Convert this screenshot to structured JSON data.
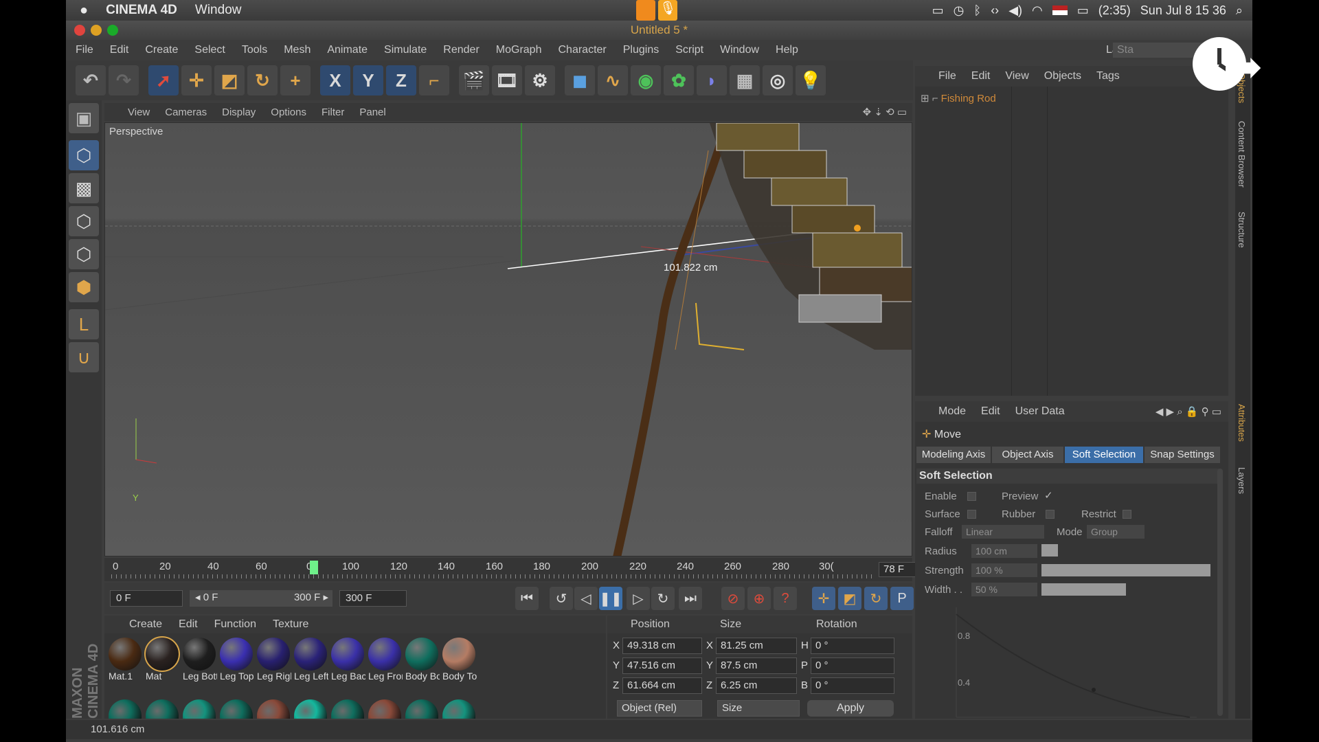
{
  "mac_menubar": {
    "app_name": "CINEMA 4D",
    "window_menu": "Window",
    "battery": "(2:35)",
    "clock": "Sun Jul 8  15 36"
  },
  "window": {
    "title": "Untitled 5 *"
  },
  "main_menu": [
    "File",
    "Edit",
    "Create",
    "Select",
    "Tools",
    "Mesh",
    "Animate",
    "Simulate",
    "Render",
    "MoGraph",
    "Character",
    "Plugins",
    "Script",
    "Window",
    "Help"
  ],
  "layout": {
    "label": "Layout:",
    "value": "Sta"
  },
  "toolbar": {
    "axis_x": "X",
    "axis_y": "Y",
    "axis_z": "Z"
  },
  "viewport": {
    "menu": [
      "View",
      "Cameras",
      "Display",
      "Options",
      "Filter",
      "Panel"
    ],
    "label": "Perspective",
    "measure": "101.822 cm",
    "axis_y": "Y"
  },
  "timeline": {
    "ticks": [
      "0",
      "20",
      "40",
      "60",
      "0",
      "100",
      "120",
      "140",
      "160",
      "180",
      "200",
      "220",
      "240",
      "260",
      "280",
      "30("
    ],
    "current_frame": "78 F",
    "playhead_position": 0.26
  },
  "playback": {
    "start_field": "0 F",
    "range_start": "◂ 0 F",
    "range_end": "300 F ▸",
    "end_field": "300 F"
  },
  "material_manager": {
    "menu": [
      "Create",
      "Edit",
      "Function",
      "Texture"
    ],
    "materials": [
      {
        "name": "Mat.1",
        "color": "#4a2a12"
      },
      {
        "name": "Mat",
        "color": "#2a2220"
      },
      {
        "name": "Leg Bott",
        "color": "#1e1e1e"
      },
      {
        "name": "Leg Top",
        "color": "#3a2fb0"
      },
      {
        "name": "Leg Rigl",
        "color": "#282070"
      },
      {
        "name": "Leg Left",
        "color": "#2a2278"
      },
      {
        "name": "Leg Bacl",
        "color": "#3a30a8"
      },
      {
        "name": "Leg Fror",
        "color": "#3a30a8"
      },
      {
        "name": "Body Bo",
        "color": "#0f6e5e"
      },
      {
        "name": "Body To",
        "color": "#b57c64"
      }
    ],
    "row2_colors": [
      "#0f6e5e",
      "#0f6e5e",
      "#14937e",
      "#0f6e5e",
      "#8a4a3a",
      "#14b89e",
      "#0f6e5e",
      "#8a4a3a",
      "#0f6e5e",
      "#14937e"
    ]
  },
  "coordinates": {
    "headers": {
      "position": "Position",
      "size": "Size",
      "rotation": "Rotation"
    },
    "rows": [
      {
        "axis": "X",
        "position": "49.318 cm",
        "size_axis": "X",
        "size": "81.25 cm",
        "rot_axis": "H",
        "rotation": "0 °"
      },
      {
        "axis": "Y",
        "position": "47.516 cm",
        "size_axis": "Y",
        "size": "87.5 cm",
        "rot_axis": "P",
        "rotation": "0 °"
      },
      {
        "axis": "Z",
        "position": "61.664 cm",
        "size_axis": "Z",
        "size": "6.25 cm",
        "rot_axis": "B",
        "rotation": "0 °"
      }
    ],
    "mode_dropdown": "Object (Rel)",
    "size_dropdown": "Size",
    "apply_label": "Apply"
  },
  "objects_panel": {
    "menu": [
      "File",
      "Edit",
      "View",
      "Objects",
      "Tags"
    ],
    "items": [
      "Fishing Rod"
    ]
  },
  "attributes": {
    "menu": [
      "Mode",
      "Edit",
      "User Data"
    ],
    "tool_name": "Move",
    "tabs": [
      "Modeling Axis",
      "Object Axis",
      "Soft Selection",
      "Snap Settings"
    ],
    "active_tab": "Soft Selection",
    "section_title": "Soft Selection",
    "enable_label": "Enable",
    "preview_label": "Preview",
    "preview_check": "✓",
    "surface_label": "Surface",
    "rubber_label": "Rubber",
    "restrict_label": "Restrict",
    "falloff_label": "Falloff",
    "falloff_value": "Linear",
    "mode_label": "Mode",
    "mode_value": "Group",
    "radius_label": "Radius",
    "radius_value": "100 cm",
    "strength_label": "Strength",
    "strength_value": "100 %",
    "width_label": "Width . .",
    "width_value": "50 %",
    "strength_level": 1.0,
    "width_level": 0.5,
    "graph_labels": [
      "0.8",
      "0.4"
    ]
  },
  "side_tabs": [
    "Objects",
    "Content Browser",
    "Structure",
    "Attributes",
    "Layers"
  ],
  "brand_vertical": "MAXON CINEMA 4D",
  "statusbar": {
    "text": "101.616 cm"
  },
  "colors": {
    "accent_blue": "#3b6ea8",
    "orange": "#e0a64b",
    "app_bg": "#3d3d3d"
  }
}
